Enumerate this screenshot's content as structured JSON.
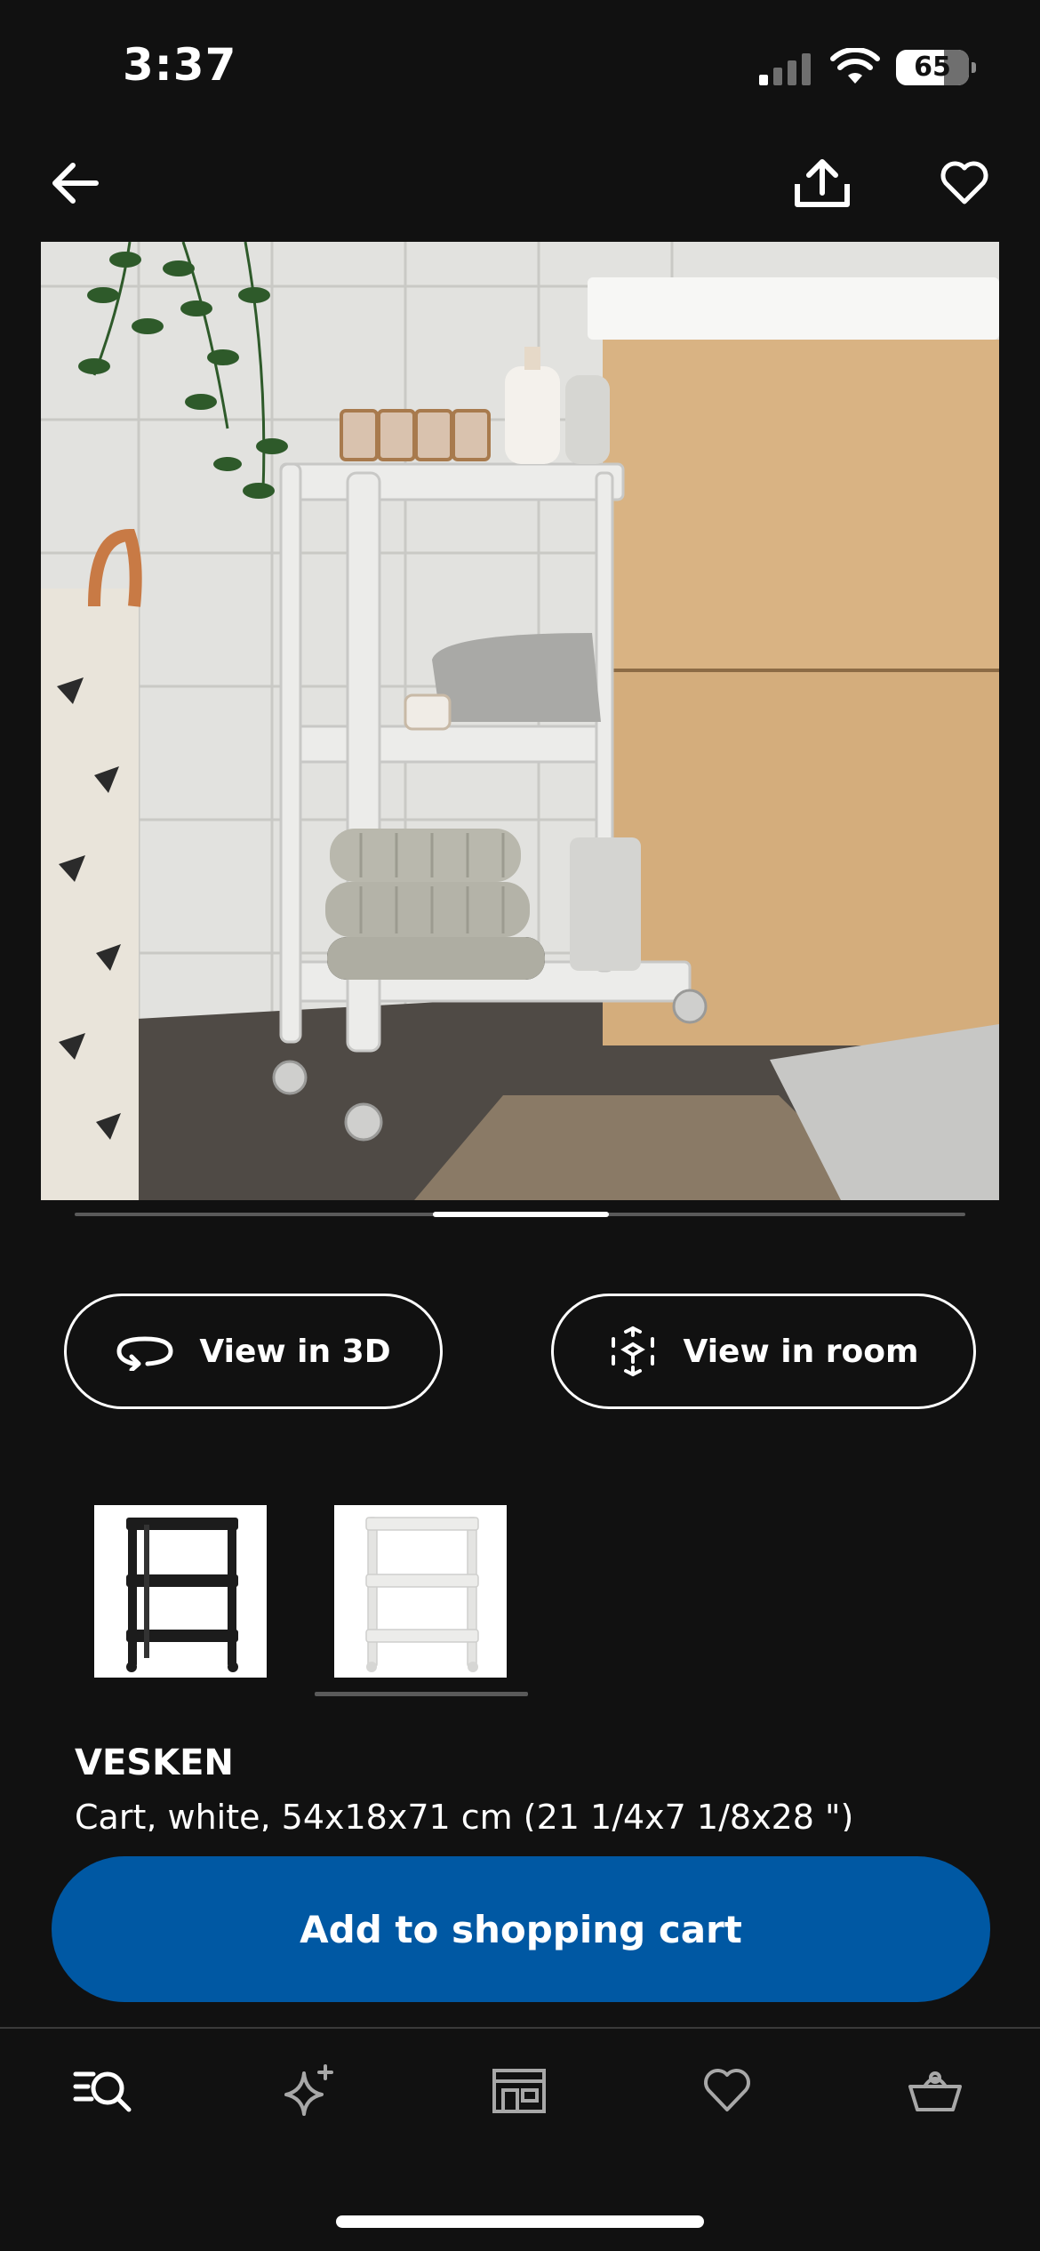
{
  "status_bar": {
    "time": "3:37",
    "battery": "65"
  },
  "header": {
    "back_icon": "arrow-left-icon",
    "share_icon": "share-upload-icon",
    "favorite_icon": "heart-outline-icon"
  },
  "gallery": {
    "image_label": "VESKEN cart in a bathroom next to a wooden vanity",
    "active_index_fraction": 0.5
  },
  "actions": {
    "view_3d": "View in 3D",
    "view_room": "View in room"
  },
  "variants": [
    {
      "name": "black",
      "selected": false
    },
    {
      "name": "white",
      "selected": true
    }
  ],
  "product": {
    "name": "VESKEN",
    "description": "Cart, white, 54x18x71 cm (21 1/4x7 1/8x28 \")"
  },
  "cta": {
    "add_to_cart": "Add to shopping cart"
  },
  "tab_bar": {
    "items": [
      "search-icon",
      "sparkle-icon",
      "store-icon",
      "heart-icon",
      "basket-icon"
    ]
  },
  "colors": {
    "background": "#111111",
    "accent": "#0058a3",
    "text": "#ffffff"
  }
}
